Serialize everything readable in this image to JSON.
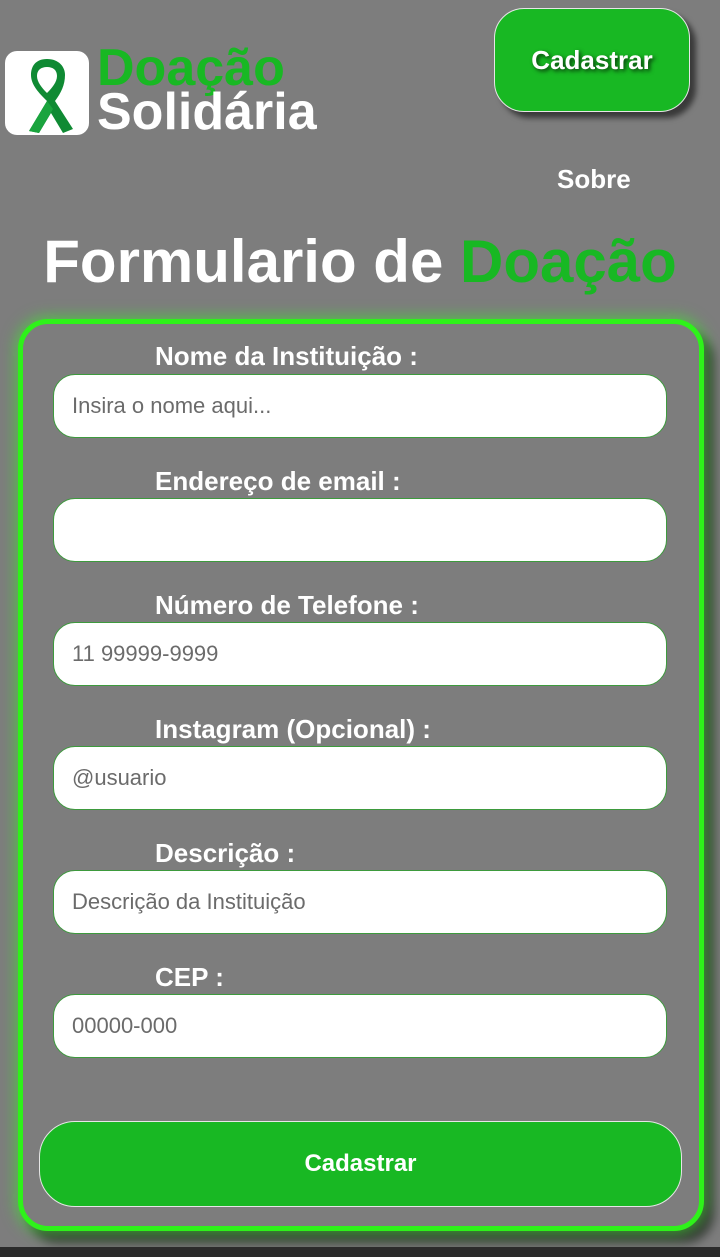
{
  "header": {
    "logo_line1": "Doação",
    "logo_line2": "Solidária",
    "logo_icon": "awareness-ribbon-icon",
    "cadastrar_label": "Cadastrar",
    "nav": {
      "sobre_label": "Sobre"
    }
  },
  "title": {
    "prefix": "Formulario de ",
    "accent": "Doação"
  },
  "form": {
    "fields": [
      {
        "label": "Nome da Instituição :",
        "placeholder": "Insira o nome aqui...",
        "value": ""
      },
      {
        "label": "Endereço de email :",
        "placeholder": "",
        "value": ""
      },
      {
        "label": "Número de Telefone :",
        "placeholder": "11 99999-9999",
        "value": ""
      },
      {
        "label": "Instagram (Opcional) :",
        "placeholder": "@usuario",
        "value": ""
      },
      {
        "label": "Descrição :",
        "placeholder": "Descrição da Instituição",
        "value": ""
      },
      {
        "label": "CEP :",
        "placeholder": "00000-000",
        "value": ""
      }
    ],
    "submit_label": "Cadastrar"
  },
  "colors": {
    "background": "#7d7d7d",
    "accent_green": "#18b823",
    "card_border_green": "#2ef21a",
    "text_white": "#ffffff",
    "bottom_strip": "#2b2b2b"
  }
}
